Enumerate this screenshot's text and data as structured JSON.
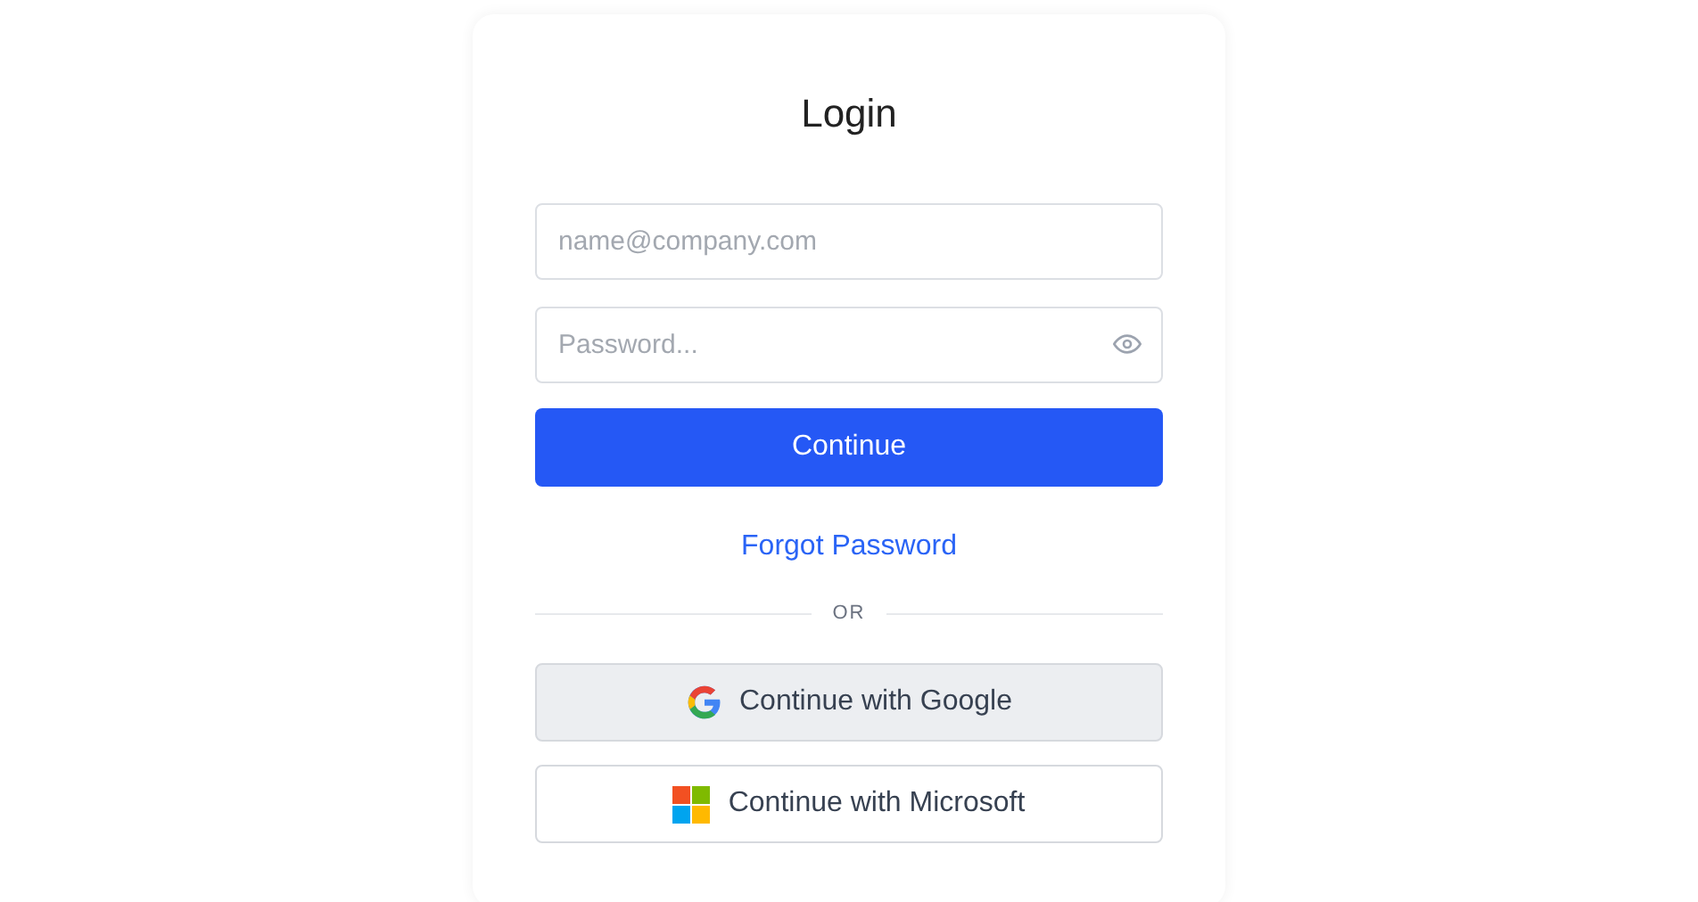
{
  "title": "Login",
  "fields": [
    {
      "kind": "email",
      "placeholder": "name@company.com"
    },
    {
      "kind": "password",
      "placeholder": "Password..."
    }
  ],
  "submit": {
    "label": "Continue"
  },
  "forgot_link": "Forgot Password",
  "divider": "OR",
  "social_buttons": [
    {
      "kind": "google",
      "label": "Continue with Google",
      "highlighted": true
    },
    {
      "kind": "microsoft",
      "label": "Continue with Microsoft",
      "highlighted": false
    }
  ]
}
